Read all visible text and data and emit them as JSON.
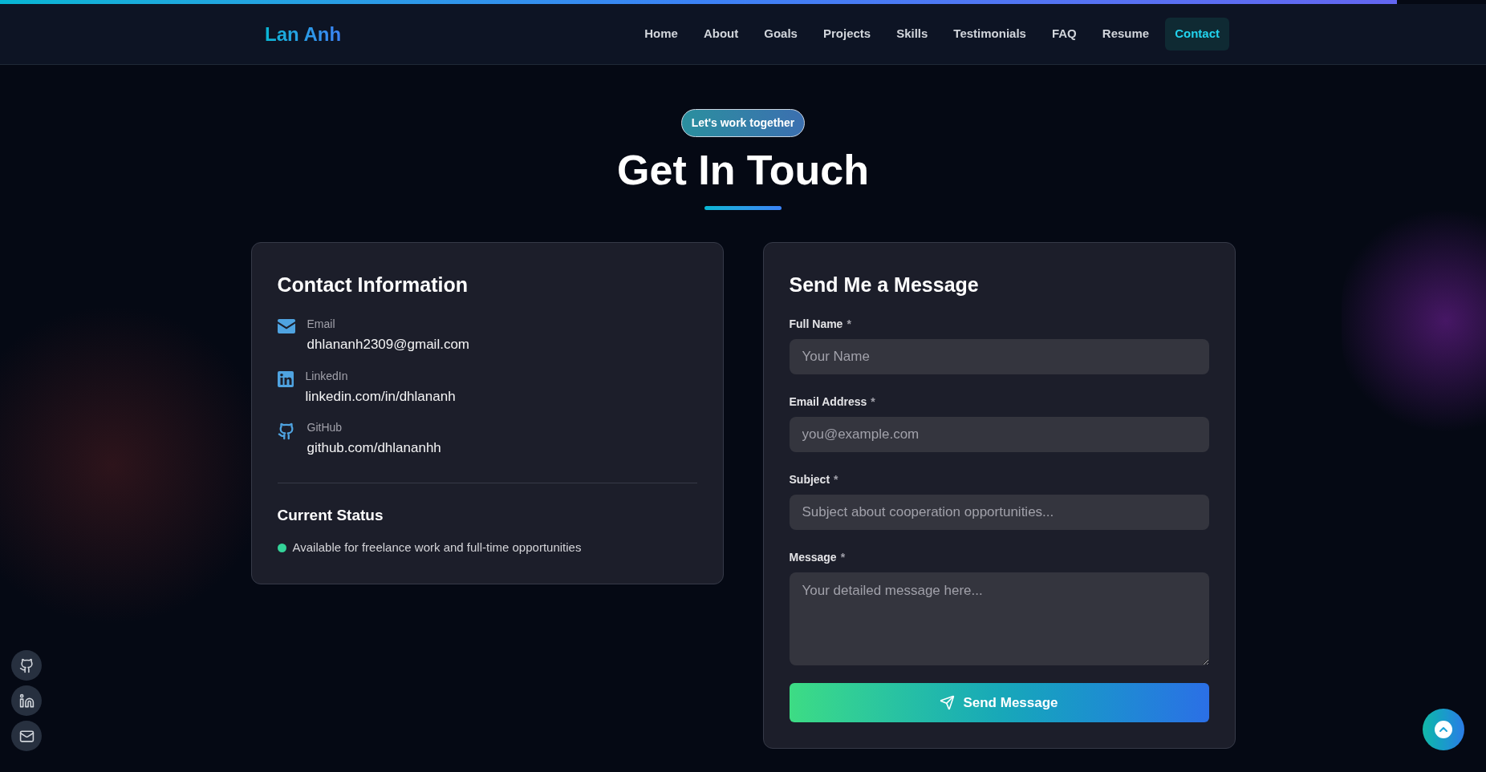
{
  "scroll_progress": {
    "level": 0.94
  },
  "header": {
    "logo": "Lan Anh",
    "nav": [
      {
        "label": "Home",
        "selected": false
      },
      {
        "label": "About",
        "selected": false
      },
      {
        "label": "Goals",
        "selected": false
      },
      {
        "label": "Projects",
        "selected": false
      },
      {
        "label": "Skills",
        "selected": false
      },
      {
        "label": "Testimonials",
        "selected": false
      },
      {
        "label": "FAQ",
        "selected": false
      },
      {
        "label": "Resume",
        "selected": false
      },
      {
        "label": "Contact",
        "selected": true
      }
    ]
  },
  "hero": {
    "badge": "Let's work together",
    "title": "Get In Touch"
  },
  "contact_info": {
    "title": "Contact Information",
    "items": [
      {
        "kind": "email",
        "label": "Email",
        "value": "dhlananh2309@gmail.com"
      },
      {
        "kind": "linkedin",
        "label": "LinkedIn",
        "value": "linkedin.com/in/dhlananh"
      },
      {
        "kind": "github",
        "label": "GitHub",
        "value": "github.com/dhlananhh"
      }
    ],
    "status_title": "Current Status",
    "status": "Available for freelance work and full-time opportunities"
  },
  "form": {
    "title": "Send Me a Message",
    "fields": [
      {
        "kind": "input",
        "label": "Full Name",
        "required": "*",
        "placeholder": "Your Name"
      },
      {
        "kind": "input",
        "label": "Email Address",
        "required": "*",
        "placeholder": "you@example.com"
      },
      {
        "kind": "input",
        "label": "Subject",
        "required": "*",
        "placeholder": "Subject about cooperation opportunities..."
      },
      {
        "kind": "textarea",
        "label": "Message",
        "required": "*",
        "placeholder": "Your detailed message here..."
      }
    ],
    "submit": "Send Message"
  },
  "social_links": [
    {
      "kind": "github"
    },
    {
      "kind": "linkedin"
    },
    {
      "kind": "email"
    }
  ]
}
